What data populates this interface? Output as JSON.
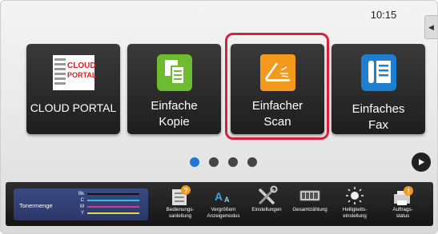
{
  "status": {
    "clock": "10:15"
  },
  "tiles": [
    {
      "label": "CLOUD PORTAL",
      "icon": "cloud-portal-logo",
      "logo_text": "CLOUD\nPORTAL"
    },
    {
      "label": "Einfache\nKopie",
      "icon": "copy-icon"
    },
    {
      "label": "Einfacher\nScan",
      "icon": "scan-icon",
      "highlighted": true
    },
    {
      "label": "Einfaches\nFax",
      "icon": "fax-icon"
    }
  ],
  "pager": {
    "pages": 4,
    "current": 1
  },
  "toner": {
    "title": "Tonermenge",
    "channels": [
      {
        "label": "Bk",
        "color": "#111111"
      },
      {
        "label": "C",
        "color": "#2ec4d8"
      },
      {
        "label": "M",
        "color": "#d63aa0"
      },
      {
        "label": "Y",
        "color": "#e2d83a"
      }
    ]
  },
  "functions": [
    {
      "label": "Bedienungs-\nsanleitung",
      "icon": "manual-icon"
    },
    {
      "label": "Vergrößern\nAnzeigemodus",
      "icon": "text-enlarge-icon"
    },
    {
      "label": "Einstellungen",
      "icon": "settings-tools-icon"
    },
    {
      "label": "Gesamtzählung",
      "icon": "counter-icon"
    },
    {
      "label": "Helligkeits-\neinstellung",
      "icon": "brightness-icon"
    },
    {
      "label": "Auftrags-\nstatus",
      "icon": "job-status-icon"
    }
  ],
  "colors": {
    "highlight": "#d4213d",
    "active_dot": "#1f78d1",
    "scan_orange": "#f39a1e",
    "copy_green": "#6dbb2e",
    "fax_blue": "#1e7fd1"
  }
}
